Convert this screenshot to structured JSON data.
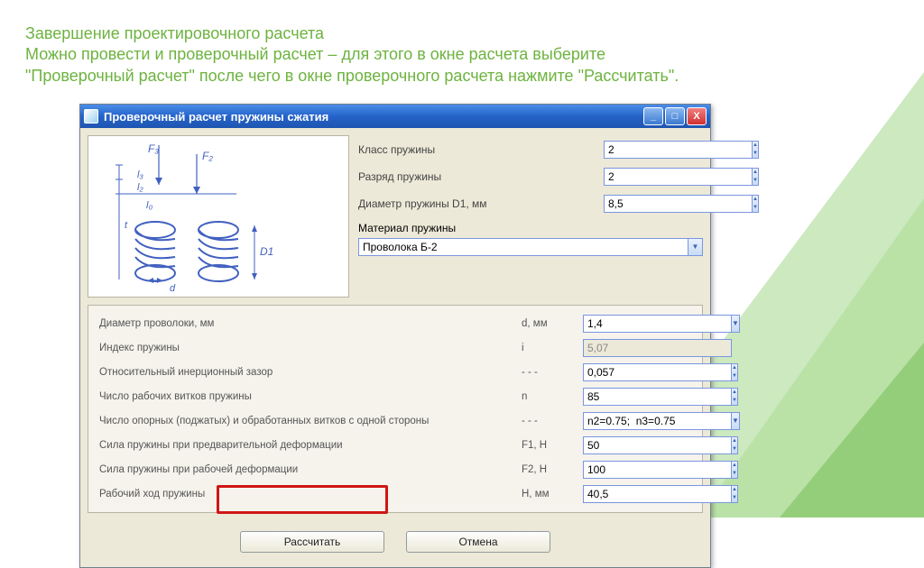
{
  "header": {
    "line1": "Завершение проектировочного расчета",
    "line2": "Можно провести и проверочный расчет – для этого в окне расчета выберите \"Проверочный расчет\" после чего в окне проверочного расчета нажмите \"Рассчитать\"."
  },
  "dialog": {
    "title": "Проверочный расчет пружины сжатия",
    "top": {
      "class_label": "Класс пружины",
      "class_value": "2",
      "rank_label": "Разряд пружины",
      "rank_value": "2",
      "dia_label": "Диаметр пружины  D1, мм",
      "dia_value": "8,5",
      "mat_label": "Материал пружины",
      "mat_value": "Проволока Б-2"
    },
    "params": [
      {
        "label": "Диаметр проволоки, мм",
        "sym": "d,  мм",
        "val": "1,4",
        "type": "combo"
      },
      {
        "label": "Индекс пружины",
        "sym": "i",
        "val": "5,07",
        "type": "readonly"
      },
      {
        "label": "Относительный инерционный зазор",
        "sym": "- - -",
        "val": "0,057",
        "type": "spin"
      },
      {
        "label": "Число рабочих витков пружины",
        "sym": "n",
        "val": "85",
        "type": "spin"
      },
      {
        "label": "Число опорных (поджатых) и обработанных витков с одной стороны",
        "sym": "- - -",
        "val": "n2=0.75;  n3=0.75",
        "type": "combo"
      },
      {
        "label": "Сила пружины при предварительной деформации",
        "sym": "F1, H",
        "val": "50",
        "type": "spin"
      },
      {
        "label": "Сила пружины при рабочей деформации",
        "sym": "F2, H",
        "val": "100",
        "type": "spin"
      },
      {
        "label": "Рабочий ход пружины",
        "sym": "H, мм",
        "val": "40,5",
        "type": "spin"
      }
    ],
    "buttons": {
      "calc": "Рассчитать",
      "cancel": "Отмена"
    }
  }
}
